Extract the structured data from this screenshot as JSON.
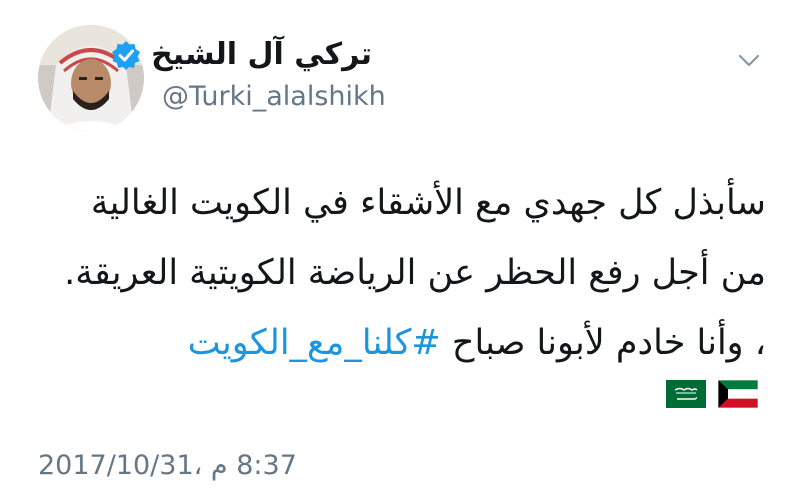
{
  "tweet": {
    "author": {
      "display_name": "تركي آل الشيخ",
      "handle": "@Turki_alalshikh",
      "verified": true,
      "avatar_icon": "user-avatar-photo"
    },
    "menu_icon": "chevron-down-icon",
    "text_lines": [
      "سأبذل كل جهدي مع الأشقاء في الكويت الغالية",
      "من أجل رفع الحظر عن الرياضة الكويتية العريقة.",
      "، وأنا خادم لأبونا صباح"
    ],
    "hashtag": "#كلنا_مع_الكويت",
    "flags": [
      "kuwait-flag-emoji",
      "saudi-flag-emoji"
    ],
    "timestamp": "8:37 م ،2017/10/31",
    "colors": {
      "text": "#14171a",
      "secondary": "#657786",
      "link": "#1b95e0",
      "verified": "#1da1f2"
    }
  }
}
